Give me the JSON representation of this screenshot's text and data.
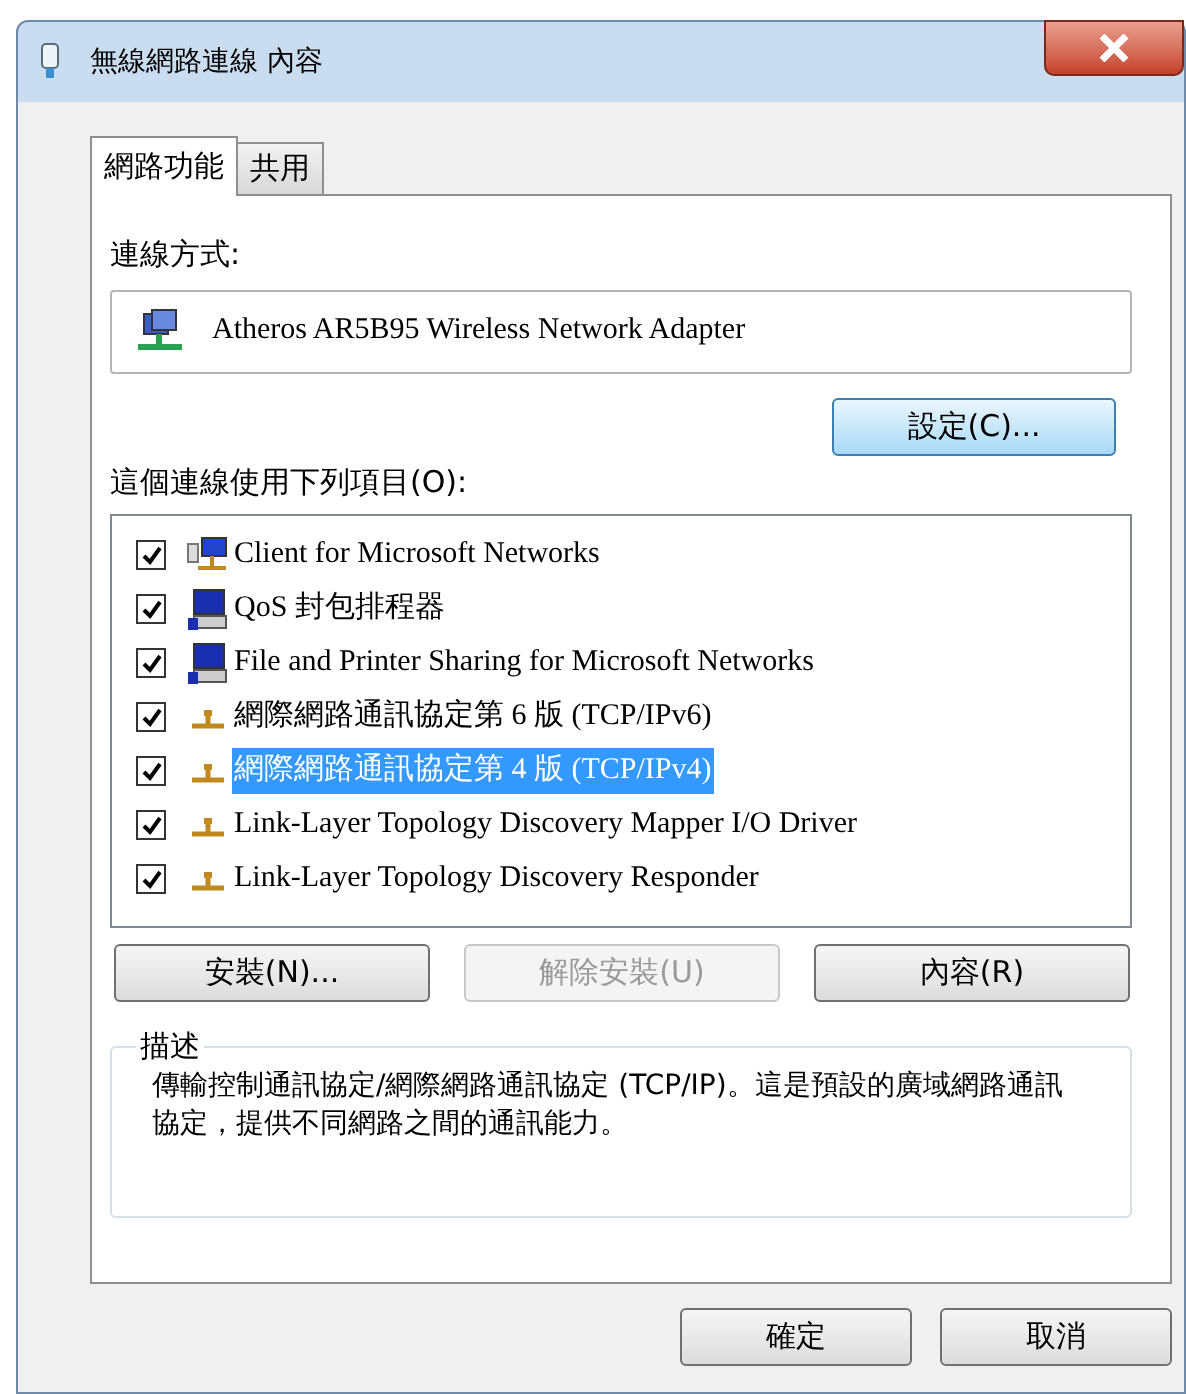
{
  "window": {
    "title": "無線網路連線 內容"
  },
  "tabs": [
    {
      "label": "網路功能",
      "selected": true
    },
    {
      "label": "共用",
      "selected": false
    }
  ],
  "connect_using": {
    "label": "連線方式:",
    "adapter": "Atheros AR5B95 Wireless Network Adapter",
    "configure_button": "設定(C)..."
  },
  "items_label": "這個連線使用下列項目(O):",
  "items": [
    {
      "label": "Client for Microsoft Networks",
      "kind": "client",
      "checked": true,
      "selected": false
    },
    {
      "label": "QoS 封包排程器",
      "kind": "service",
      "checked": true,
      "selected": false
    },
    {
      "label": "File and Printer Sharing for Microsoft Networks",
      "kind": "service",
      "checked": true,
      "selected": false
    },
    {
      "label": "網際網路通訊協定第 6 版 (TCP/IPv6)",
      "kind": "protocol",
      "checked": true,
      "selected": false
    },
    {
      "label": "網際網路通訊協定第 4 版 (TCP/IPv4)",
      "kind": "protocol",
      "checked": true,
      "selected": true
    },
    {
      "label": "Link-Layer Topology Discovery Mapper I/O Driver",
      "kind": "protocol",
      "checked": true,
      "selected": false
    },
    {
      "label": "Link-Layer Topology Discovery Responder",
      "kind": "protocol",
      "checked": true,
      "selected": false
    }
  ],
  "item_buttons": [
    {
      "label": "安裝(N)...",
      "disabled": false
    },
    {
      "label": "解除安裝(U)",
      "disabled": true
    },
    {
      "label": "內容(R)",
      "disabled": false
    }
  ],
  "description": {
    "title": "描述",
    "text": "傳輸控制通訊協定/網際網路通訊協定 (TCP/IP)。這是預設的廣域網路通訊協定，提供不同網路之間的通訊能力。"
  },
  "footer_buttons": [
    {
      "label": "確定"
    },
    {
      "label": "取消"
    }
  ]
}
